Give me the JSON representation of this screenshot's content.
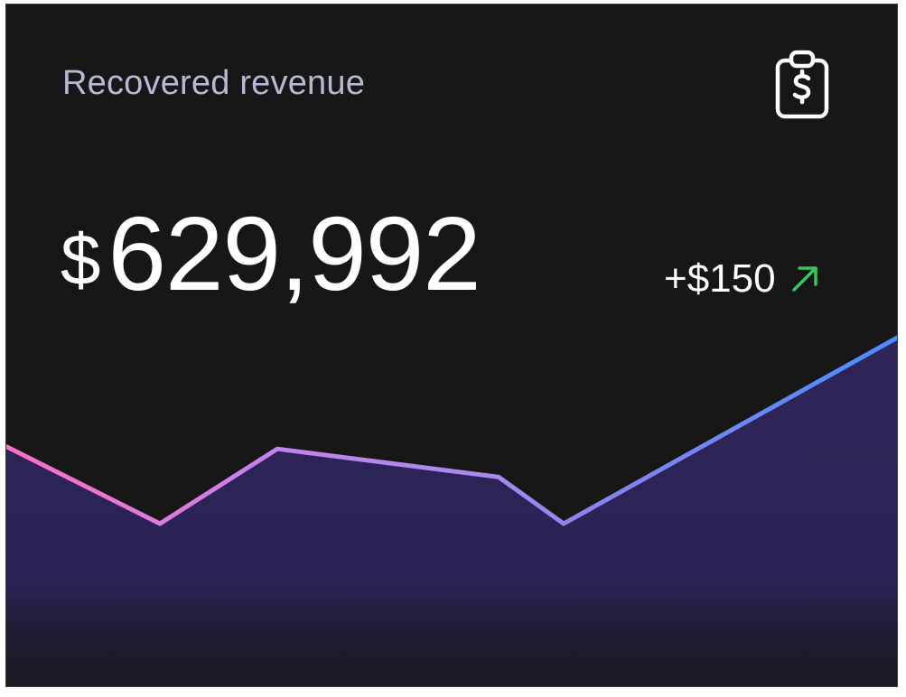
{
  "card": {
    "title": "Recovered revenue",
    "icon": "clipboard-dollar-icon",
    "amount": {
      "currency": "$",
      "value": "629,992"
    },
    "delta": {
      "text": "+$150",
      "direction": "up",
      "icon": "arrow-up-right-icon",
      "color": "#34c759"
    }
  },
  "chart_data": {
    "type": "area",
    "series": [
      {
        "values": [
          0.53,
          0.2,
          0.52,
          0.4,
          0.2,
          1.0
        ]
      }
    ],
    "x": [
      0,
      1,
      2,
      3,
      4,
      5
    ],
    "gradient_colors": [
      "#ff6ec7",
      "#b97cf0",
      "#8a7ff0",
      "#4a8cff"
    ],
    "fill_color": "#2f2558",
    "grid": false
  }
}
